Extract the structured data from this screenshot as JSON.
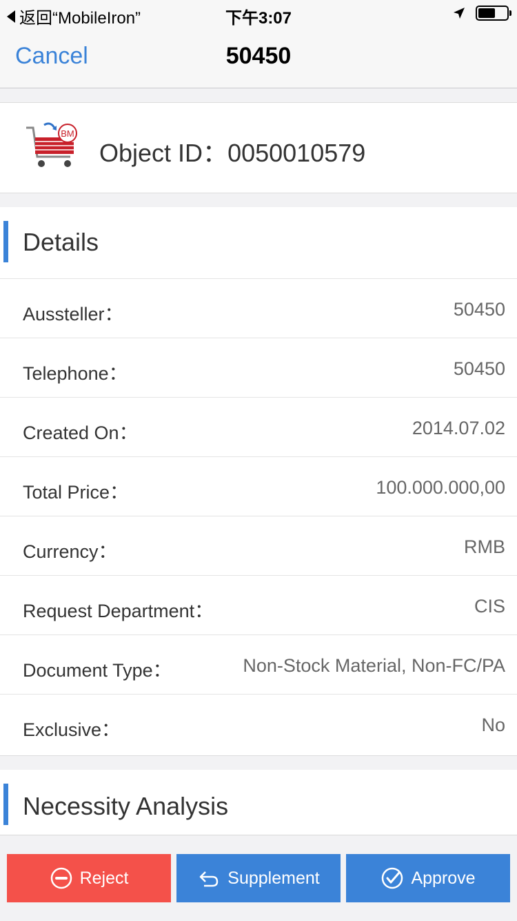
{
  "status_bar": {
    "back_label": "返回“MobileIron”",
    "time": "下午3:07"
  },
  "nav": {
    "cancel_label": "Cancel",
    "title": "50450"
  },
  "object": {
    "label": "Object ID：",
    "value": "0050010579",
    "badge": "BM"
  },
  "details": {
    "title": "Details",
    "rows": [
      {
        "label": "Aussteller：",
        "value": "50450"
      },
      {
        "label": "Telephone：",
        "value": "50450"
      },
      {
        "label": "Created On：",
        "value": "2014.07.02"
      },
      {
        "label": "Total Price：",
        "value": "100.000.000,00"
      },
      {
        "label": "Currency：",
        "value": "RMB"
      },
      {
        "label": "Request Department：",
        "value": "CIS"
      },
      {
        "label": "Document Type：",
        "value": "Non-Stock Material, Non-FC/PA"
      },
      {
        "label": "Exclusive：",
        "value": "No"
      }
    ]
  },
  "necessity": {
    "title": "Necessity Analysis"
  },
  "actions": {
    "reject_label": "Reject",
    "supplement_label": "Supplement",
    "approve_label": "Approve"
  },
  "colors": {
    "accent": "#3b83d8",
    "reject": "#f4514a"
  },
  "icons": {
    "location": "location-arrow-icon",
    "battery": "battery-icon",
    "cart": "shopping-cart-icon",
    "reject": "minus-circle-icon",
    "supplement": "reply-arrow-icon",
    "approve": "check-circle-icon"
  }
}
